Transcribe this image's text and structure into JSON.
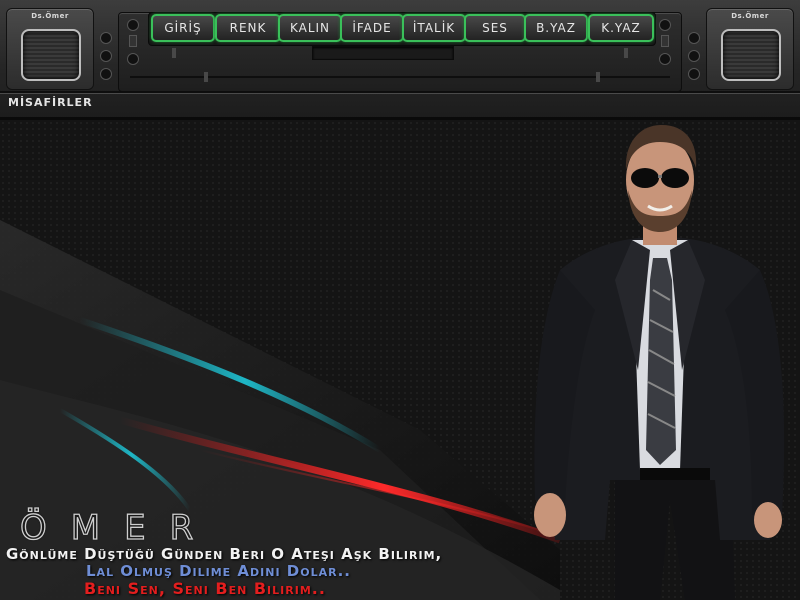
{
  "speakers": {
    "left_label": "Ds.Ömer",
    "right_label": "Ds.Ömer"
  },
  "toolbar": {
    "buttons": [
      "GİRİŞ",
      "RENK",
      "KALIN",
      "İFADE",
      "İTALİK",
      "SES",
      "B.YAZ",
      "K.YAZ"
    ]
  },
  "guests_label": "MİSAFİRLER",
  "signature": "ÖMER",
  "poem": {
    "line1": "Gönlüme Düştüğü Günden Beri O Ateşi Aşk Bilirim,",
    "line2": "Lal Olmuş Dilime Adını Dolar..",
    "line3": "Beni Sen, Seni Ben Bilirim.."
  },
  "colors": {
    "button_border": "#3ac05a",
    "line1": "#f2f2f2",
    "line2": "#6f8ed6",
    "line3": "#e31e1e",
    "accent_cyan": "#1ec7d8",
    "accent_red": "#e01a1a"
  }
}
